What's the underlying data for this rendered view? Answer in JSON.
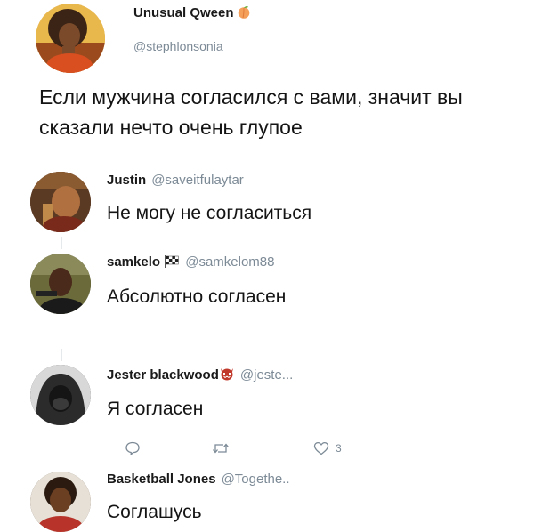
{
  "original": {
    "name": "Unusual Qween",
    "handle": "@stephlonsonia",
    "text": "Если мужчина согласился с вами, значит вы сказали нечто очень глупое"
  },
  "replies": [
    {
      "name": "Justin",
      "handle": "@saveitfulaytar",
      "text": "Не могу не согласиться"
    },
    {
      "name": "samkelo",
      "handle": "@samkelom88",
      "text": "Абсолютно согласен"
    },
    {
      "name": "Jester blackwood",
      "handle": "@jeste...",
      "text": "Я согласен",
      "actions": {
        "like_count": "3"
      }
    },
    {
      "name": "Basketball Jones",
      "handle": "@Togethe..",
      "text": "Соглашусь"
    }
  ],
  "icons": {
    "original_badge": "peach-emoji-icon",
    "samkelo_badge": "checkered-flag-icon",
    "jester_badge": "devil-emoji-icon",
    "reply": "reply-icon",
    "retweet": "retweet-icon",
    "like": "heart-icon"
  },
  "colors": {
    "handle_gray": "#7c8a96",
    "text": "#141414",
    "background": "#ffffff"
  }
}
